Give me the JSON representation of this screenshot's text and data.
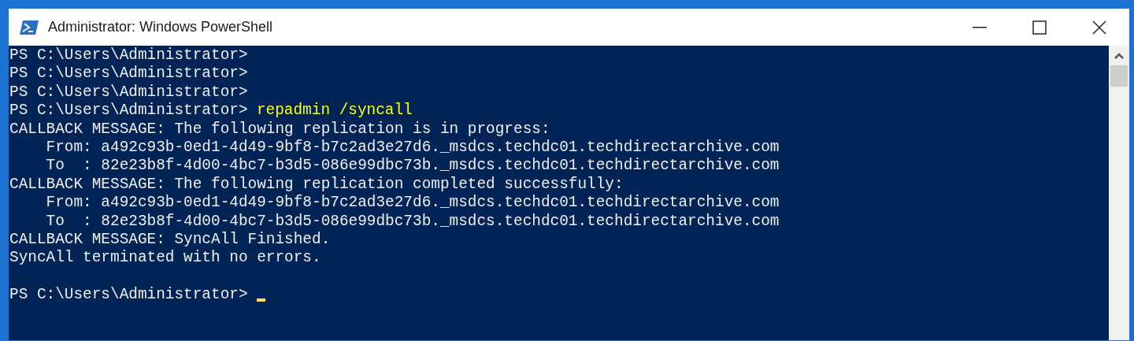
{
  "window": {
    "title": "Administrator: Windows PowerShell"
  },
  "console": {
    "lines": [
      {
        "kind": "prompt",
        "prompt": "PS C:\\Users\\Administrator>"
      },
      {
        "kind": "prompt",
        "prompt": "PS C:\\Users\\Administrator>"
      },
      {
        "kind": "prompt",
        "prompt": "PS C:\\Users\\Administrator>"
      },
      {
        "kind": "prompt",
        "prompt": "PS C:\\Users\\Administrator>",
        "command": "repadmin /syncall"
      },
      {
        "kind": "output",
        "text": "CALLBACK MESSAGE: The following replication is in progress:"
      },
      {
        "kind": "output",
        "text": "    From: a492c93b-0ed1-4d49-9bf8-b7c2ad3e27d6._msdcs.techdc01.techdirectarchive.com"
      },
      {
        "kind": "output",
        "text": "    To  : 82e23b8f-4d00-4bc7-b3d5-086e99dbc73b._msdcs.techdc01.techdirectarchive.com"
      },
      {
        "kind": "output",
        "text": "CALLBACK MESSAGE: The following replication completed successfully:"
      },
      {
        "kind": "output",
        "text": "    From: a492c93b-0ed1-4d49-9bf8-b7c2ad3e27d6._msdcs.techdc01.techdirectarchive.com"
      },
      {
        "kind": "output",
        "text": "    To  : 82e23b8f-4d00-4bc7-b3d5-086e99dbc73b._msdcs.techdc01.techdirectarchive.com"
      },
      {
        "kind": "output",
        "text": "CALLBACK MESSAGE: SyncAll Finished."
      },
      {
        "kind": "output",
        "text": "SyncAll terminated with no errors."
      },
      {
        "kind": "blank"
      },
      {
        "kind": "prompt",
        "prompt": "PS C:\\Users\\Administrator>",
        "cursor": true
      }
    ]
  }
}
